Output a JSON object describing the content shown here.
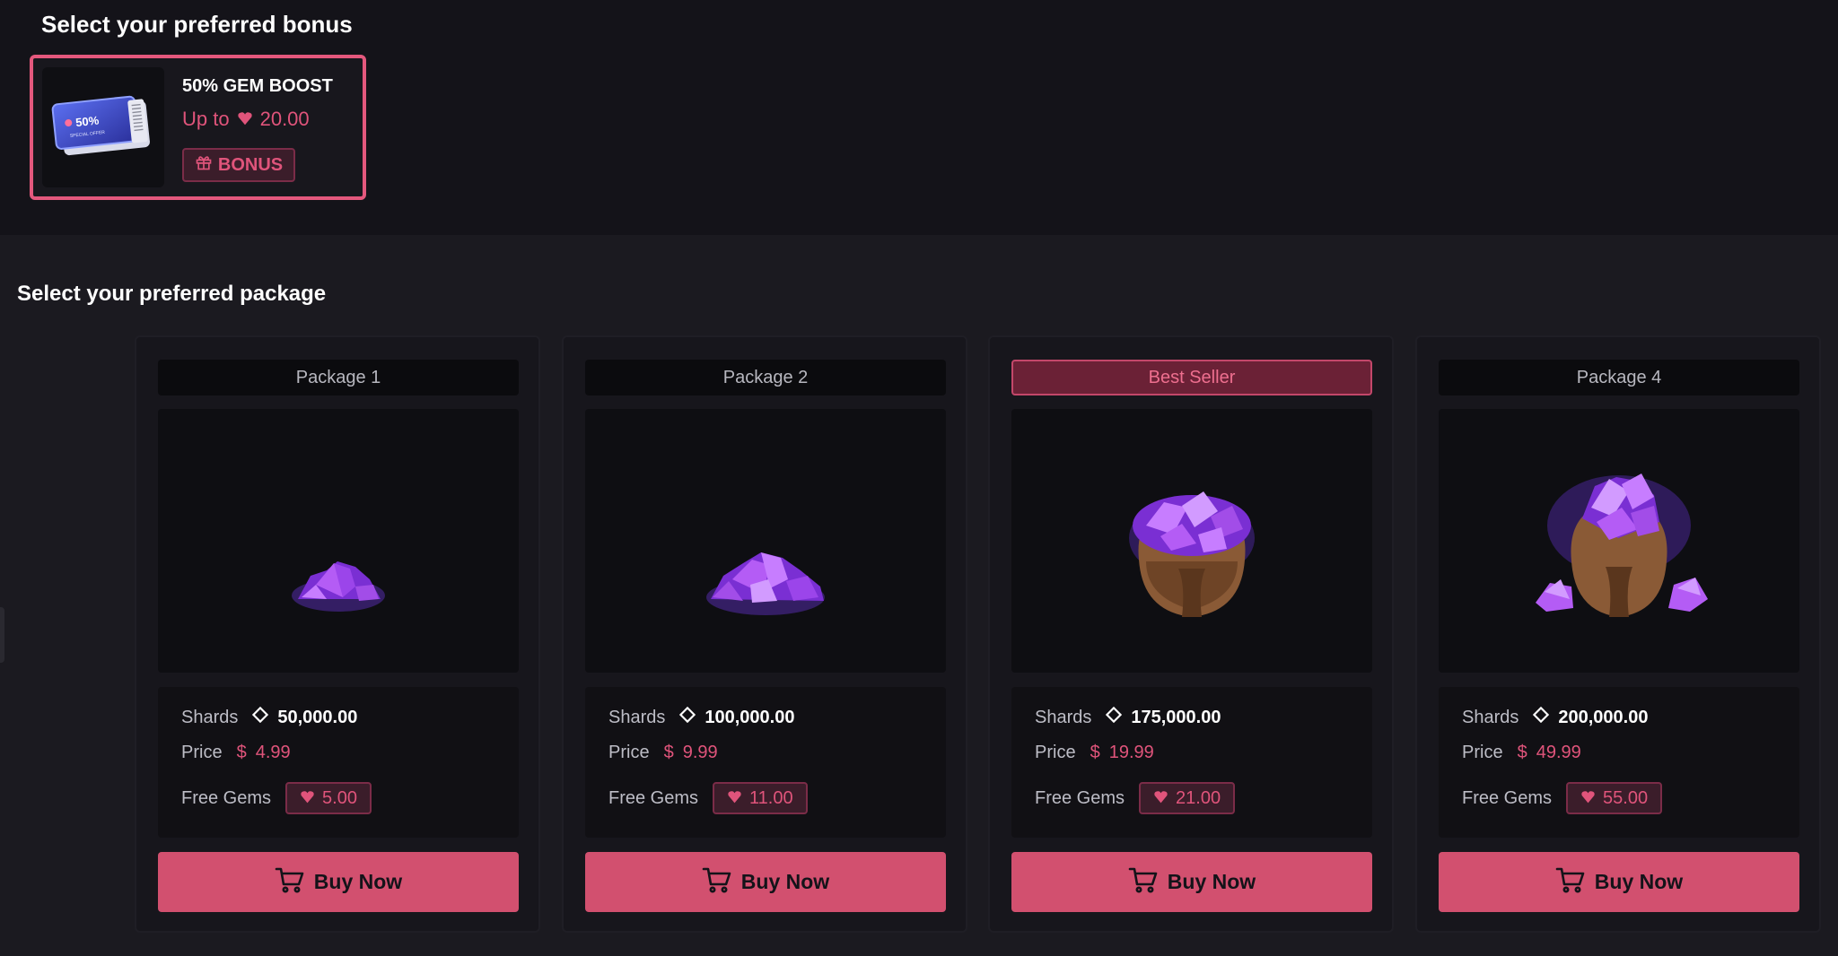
{
  "bonus_section": {
    "title": "Select your preferred bonus",
    "card": {
      "name": "50% GEM BOOST",
      "amount_prefix": "Up to",
      "amount": "20.00",
      "tag": "BONUS",
      "ticket_text": "50%",
      "ticket_sub": "SPECIAL OFFER"
    }
  },
  "package_section": {
    "title": "Select your preferred package",
    "packages": [
      {
        "label": "Package 1",
        "highlight": false,
        "shards_label": "Shards",
        "shards": "50,000.00",
        "price_label": "Price",
        "currency": "$",
        "price": "4.99",
        "gems_label": "Free Gems",
        "gems": "5.00",
        "button": "Buy Now"
      },
      {
        "label": "Package 2",
        "highlight": false,
        "shards_label": "Shards",
        "shards": "100,000.00",
        "price_label": "Price",
        "currency": "$",
        "price": "9.99",
        "gems_label": "Free Gems",
        "gems": "11.00",
        "button": "Buy Now"
      },
      {
        "label": "Best Seller",
        "highlight": true,
        "shards_label": "Shards",
        "shards": "175,000.00",
        "price_label": "Price",
        "currency": "$",
        "price": "19.99",
        "gems_label": "Free Gems",
        "gems": "21.00",
        "button": "Buy Now"
      },
      {
        "label": "Package 4",
        "highlight": false,
        "shards_label": "Shards",
        "shards": "200,000.00",
        "price_label": "Price",
        "currency": "$",
        "price": "49.99",
        "gems_label": "Free Gems",
        "gems": "55.00",
        "button": "Buy Now"
      }
    ]
  },
  "colors": {
    "accent": "#d2506f",
    "accent_text": "#e0547b",
    "background": "#141319",
    "card": "#17161c"
  },
  "icons": {
    "gem": "heart-gem-icon",
    "shard": "diamond-outline-icon",
    "cart": "cart-icon",
    "gift": "gift-icon"
  }
}
